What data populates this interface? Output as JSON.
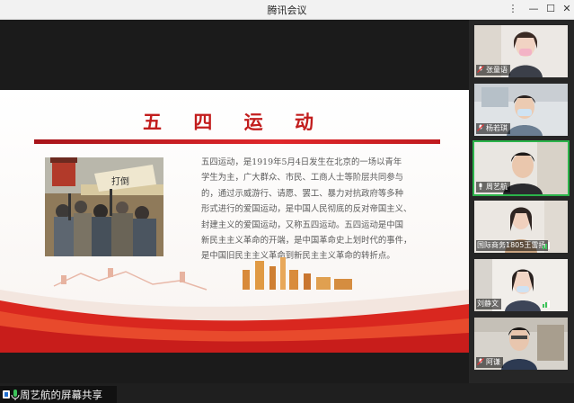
{
  "window": {
    "title": "腾讯会议"
  },
  "slide": {
    "title": "五 四 运 动",
    "body": "五四运动，是1919年5月4日发生在北京的一场以青年\n学生为主，广大群众、市民、工商人士等阶层共同参与\n的，通过示威游行、请愿、罢工、暴力对抗政府等多种\n形式进行的爱国运动，是中国人民彻底的反对帝国主义、\n封建主义的爱国运动，又称五四运动。五四运动是中国\n新民主主义革命的开端，是中国革命史上划时代的事件，\n是中国旧民主主义革命到新民主主义革命的转折点。",
    "photo_banner": "打倒"
  },
  "share": {
    "label": "周艺航的屏幕共享"
  },
  "participants": [
    {
      "name": "张童语",
      "mic": "muted"
    },
    {
      "name": "杨若琪",
      "mic": "muted"
    },
    {
      "name": "周艺航",
      "mic": "on"
    },
    {
      "name": "国际商务1805王雷扬",
      "mic": "speaking"
    },
    {
      "name": "刘静文",
      "mic": "speaking"
    },
    {
      "name": "阿谦",
      "mic": "muted"
    }
  ],
  "colors": {
    "accent_red": "#c21d1d",
    "active_green": "#2bb34a"
  },
  "icons": [
    "more-icon",
    "minimize-icon",
    "maximize-icon",
    "close-icon",
    "mic-icon",
    "mic-muted-icon",
    "volume-level-icon"
  ]
}
